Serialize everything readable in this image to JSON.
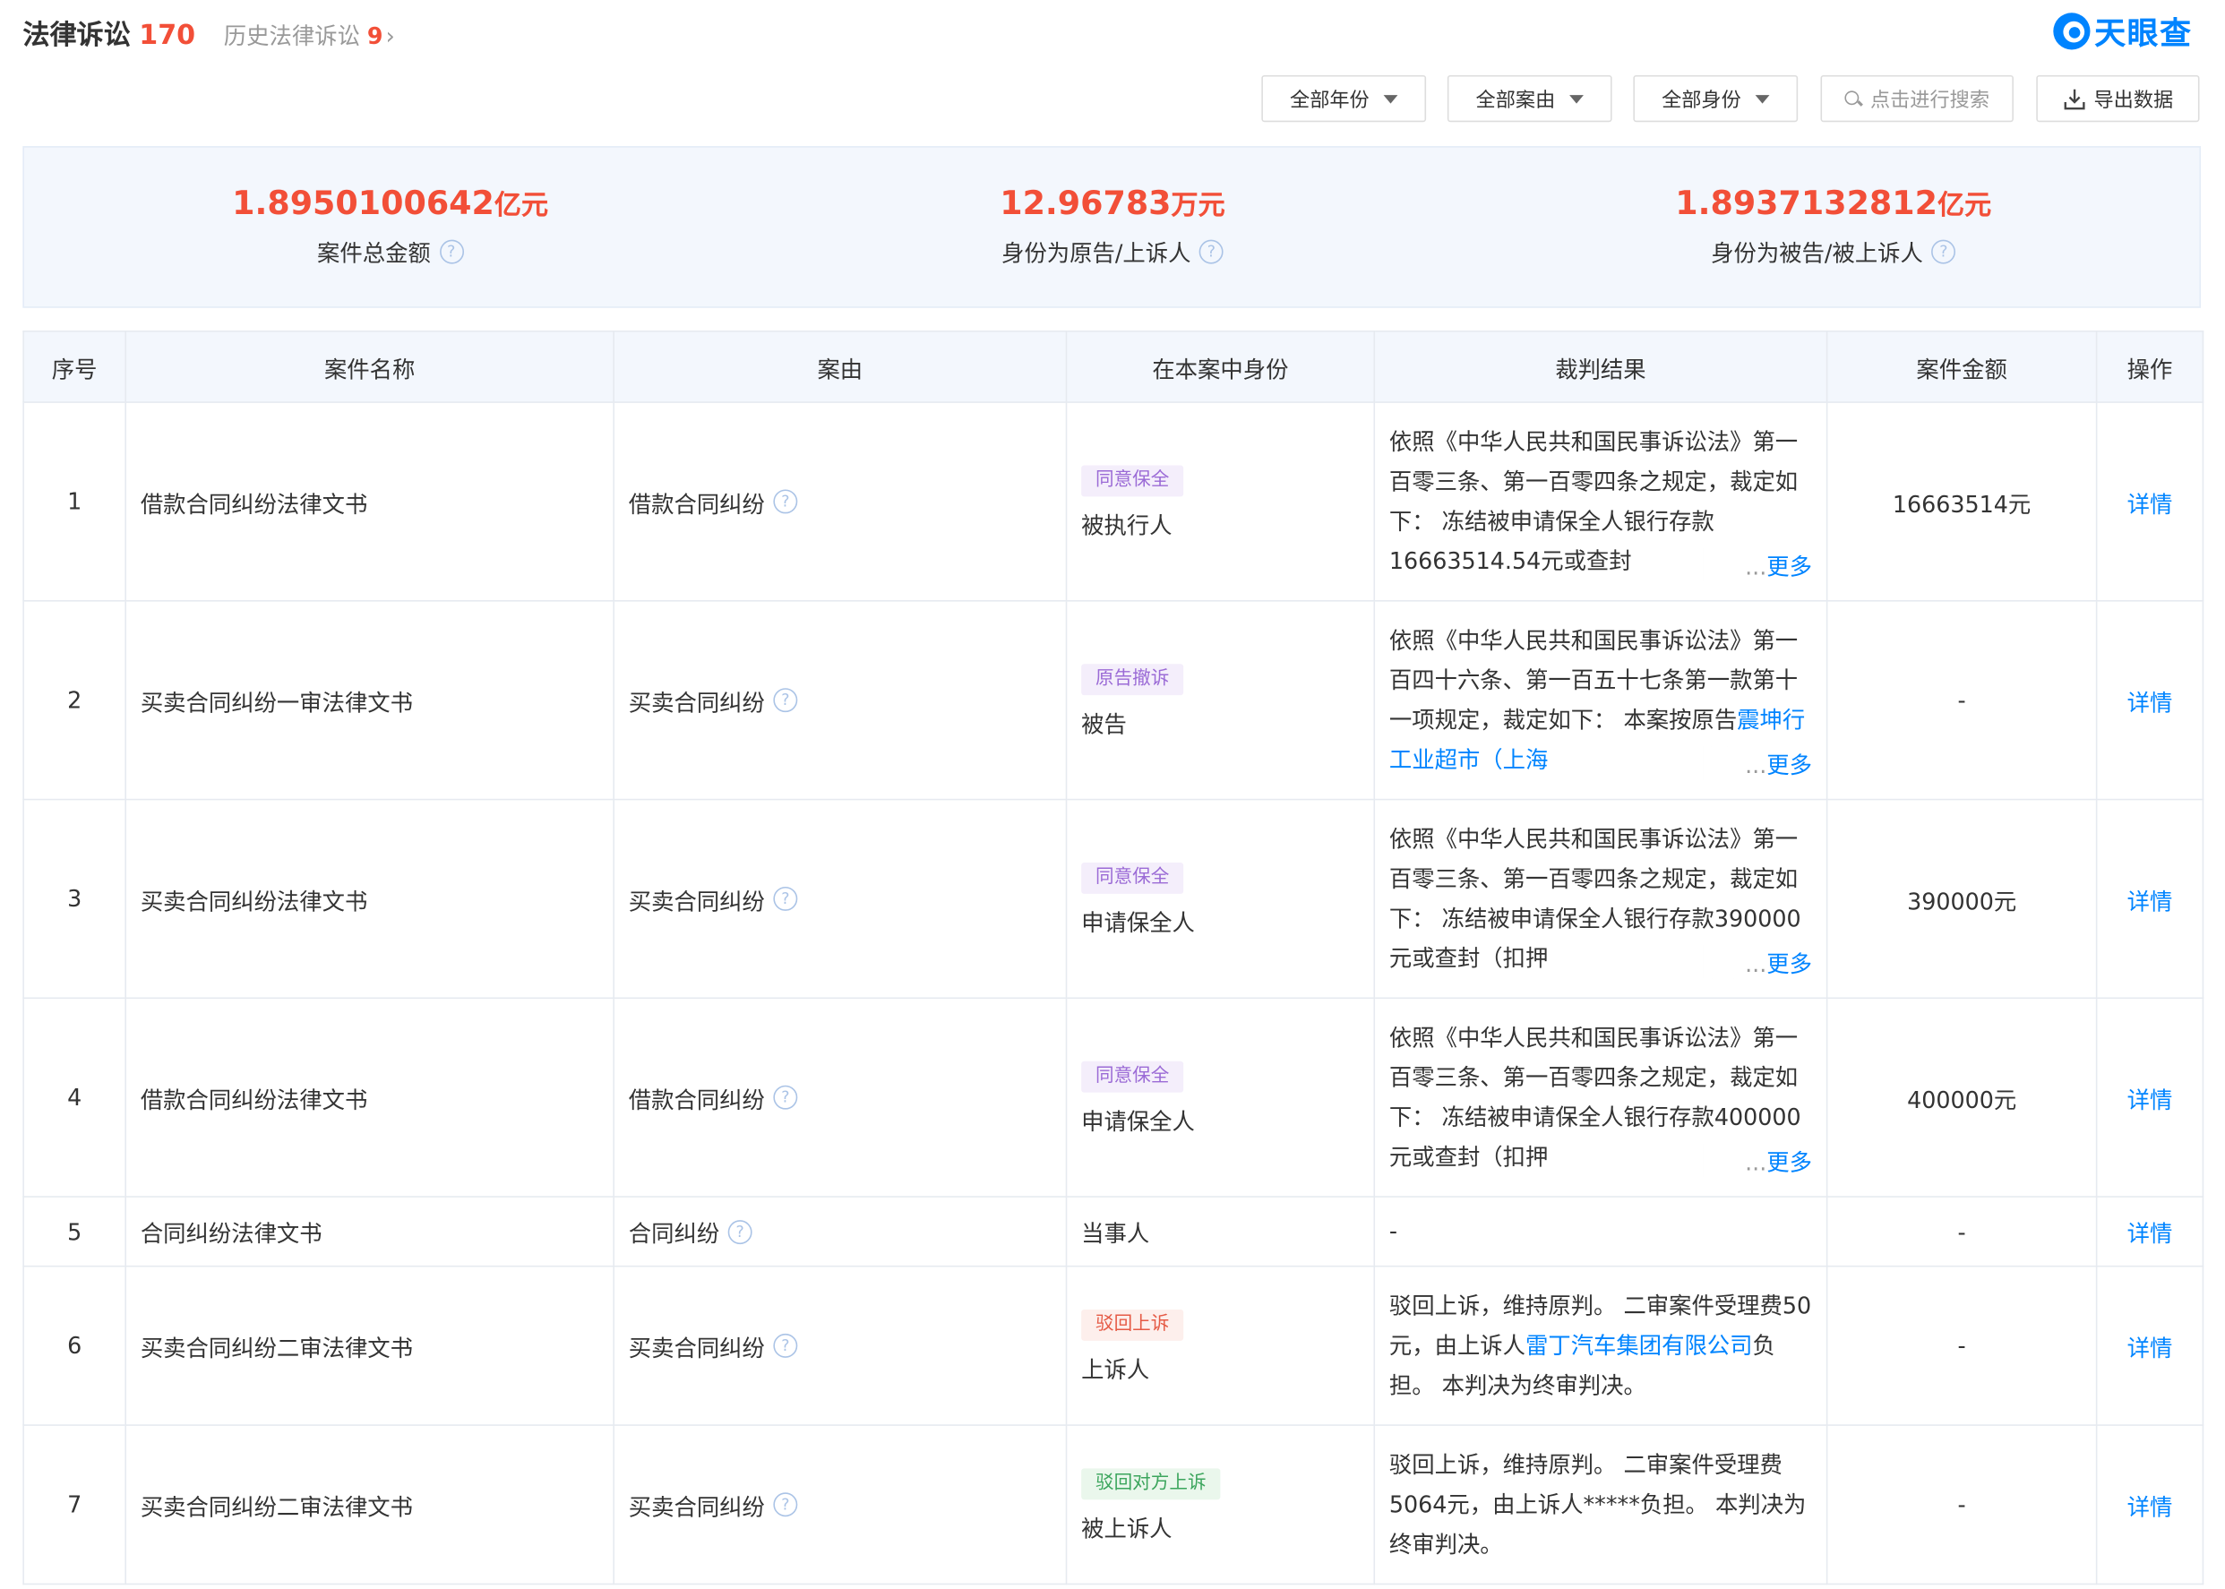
{
  "header": {
    "title": "法律诉讼",
    "count": "170",
    "history_label": "历史法律诉讼",
    "history_count": "9",
    "history_arrow": "›",
    "logo_text": "天眼查"
  },
  "toolbar": {
    "year_filter": "全部年份",
    "reason_filter": "全部案由",
    "identity_filter": "全部身份",
    "search_placeholder": "点击进行搜索",
    "export_label": "导出数据"
  },
  "summary": [
    {
      "value": "1.8950100642",
      "unit": "亿元",
      "label": "案件总金额"
    },
    {
      "value": "12.96783",
      "unit": "万元",
      "label": "身份为原告/上诉人"
    },
    {
      "value": "1.8937132812",
      "unit": "亿元",
      "label": "身份为被告/被上诉人"
    }
  ],
  "table": {
    "headers": [
      "序号",
      "案件名称",
      "案由",
      "在本案中身份",
      "裁判结果",
      "案件金额",
      "操作"
    ],
    "rows": [
      {
        "index": "1",
        "name": "借款合同纠纷法律文书",
        "reason": "借款合同纠纷",
        "tag": "同意保全",
        "role": "被执行人",
        "result": "依照《中华人民共和国民事诉讼法》第一百零三条、第一百零四条之规定，裁定如下： 冻结被申请保全人银行存款16663514.54元或查封",
        "result_link": "",
        "result_tail": "",
        "amount": "16663514元",
        "action": "详情"
      },
      {
        "index": "2",
        "name": "买卖合同纠纷一审法律文书",
        "reason": "买卖合同纠纷",
        "tag": "原告撤诉",
        "role": "被告",
        "result": "依照《中华人民共和国民事诉讼法》第一百四十六条、第一百五十七条第一款第十一项规定，裁定如下： 本案按原告",
        "result_link": "震坤行工业超市（上海",
        "result_tail": "",
        "amount": "-",
        "action": "详情"
      },
      {
        "index": "3",
        "name": "买卖合同纠纷法律文书",
        "reason": "买卖合同纠纷",
        "tag": "同意保全",
        "role": "申请保全人",
        "result": "依照《中华人民共和国民事诉讼法》第一百零三条、第一百零四条之规定，裁定如下： 冻结被申请保全人银行存款390000元或查封（扣押",
        "result_link": "",
        "result_tail": "",
        "amount": "390000元",
        "action": "详情"
      },
      {
        "index": "4",
        "name": "借款合同纠纷法律文书",
        "reason": "借款合同纠纷",
        "tag": "同意保全",
        "role": "申请保全人",
        "result": "依照《中华人民共和国民事诉讼法》第一百零三条、第一百零四条之规定，裁定如下： 冻结被申请保全人银行存款400000元或查封（扣押",
        "result_link": "",
        "result_tail": "",
        "amount": "400000元",
        "action": "详情"
      },
      {
        "index": "5",
        "name": "合同纠纷法律文书",
        "reason": "合同纠纷",
        "tag": "",
        "role": "当事人",
        "result": "-",
        "result_link": "",
        "result_tail": "",
        "amount": "-",
        "action": "详情"
      },
      {
        "index": "6",
        "name": "买卖合同纠纷二审法律文书",
        "reason": "买卖合同纠纷",
        "tag": "驳回上诉",
        "role": "上诉人",
        "result": "驳回上诉，维持原判。 二审案件受理费50元，由上诉人",
        "result_link": "雷丁汽车集团有限公司",
        "result_tail": "负担。 本判决为终审判决。",
        "amount": "-",
        "action": "详情"
      },
      {
        "index": "7",
        "name": "买卖合同纠纷二审法律文书",
        "reason": "买卖合同纠纷",
        "tag": "驳回对方上诉",
        "role": "被上诉人",
        "result": "驳回上诉，维持原判。 二审案件受理费5064元，由上诉人*****负担。 本判决为终审判决。",
        "result_link": "",
        "result_tail": "",
        "amount": "-",
        "action": "详情"
      }
    ],
    "more_label": "更多",
    "more_dots": "..."
  },
  "colors": {
    "accent_red": "#f24f38",
    "link_blue": "#0084ff",
    "panel_bg": "#f3f7fd"
  },
  "icons": [
    "help-circle-icon",
    "caret-down-icon",
    "search-icon",
    "download-icon",
    "tianyancha-logo-icon"
  ]
}
